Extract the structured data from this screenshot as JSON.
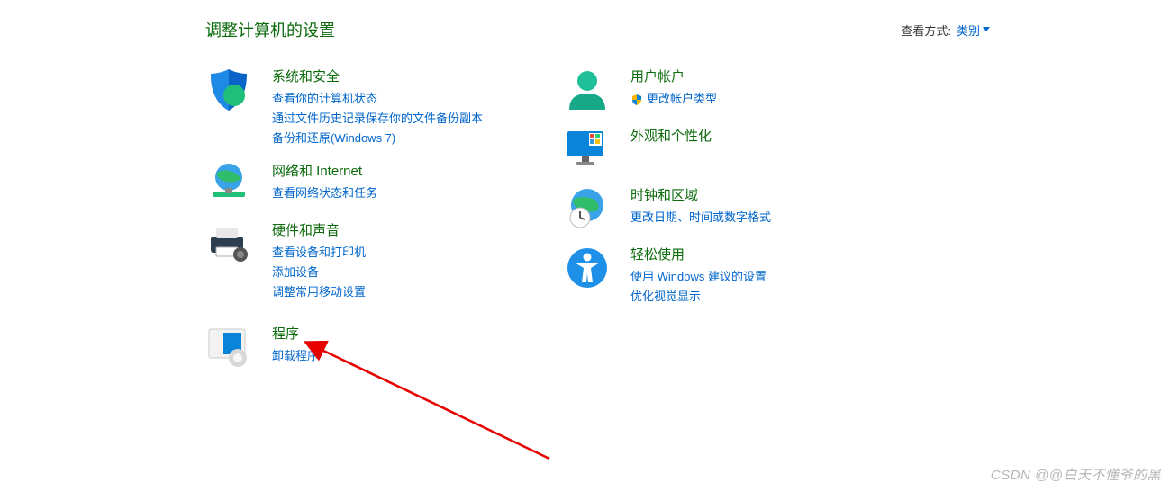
{
  "header": {
    "title": "调整计算机的设置",
    "viewByLabel": "查看方式:",
    "viewByValue": "类别"
  },
  "left": {
    "systemSecurity": {
      "title": "系统和安全",
      "links": [
        "查看你的计算机状态",
        "通过文件历史记录保存你的文件备份副本",
        "备份和还原(Windows 7)"
      ]
    },
    "network": {
      "title": "网络和 Internet",
      "links": [
        "查看网络状态和任务"
      ]
    },
    "hardware": {
      "title": "硬件和声音",
      "links": [
        "查看设备和打印机",
        "添加设备",
        "调整常用移动设置"
      ]
    },
    "programs": {
      "title": "程序",
      "links": [
        "卸载程序"
      ]
    }
  },
  "right": {
    "userAccounts": {
      "title": "用户帐户",
      "links": [
        "更改帐户类型"
      ]
    },
    "appearance": {
      "title": "外观和个性化",
      "links": []
    },
    "clockRegion": {
      "title": "时钟和区域",
      "links": [
        "更改日期、时间或数字格式"
      ]
    },
    "easeOfAccess": {
      "title": "轻松使用",
      "links": [
        "使用 Windows 建议的设置",
        "优化视觉显示"
      ]
    }
  },
  "watermark": "CSDN @@白天不懂爷的黑"
}
